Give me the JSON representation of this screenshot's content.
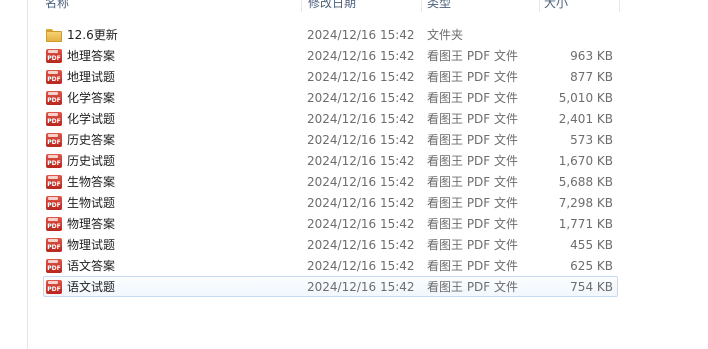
{
  "header": {
    "name": "名称",
    "date": "修改日期",
    "type": "类型",
    "size": "大小"
  },
  "files": [
    {
      "name": "12.6更新",
      "date": "2024/12/16 15:42",
      "type": "文件夹",
      "size": "",
      "icon": "folder-icon"
    },
    {
      "name": "地理答案",
      "date": "2024/12/16 15:42",
      "type": "看图王 PDF 文件",
      "size": "963 KB",
      "icon": "pdf-icon"
    },
    {
      "name": "地理试题",
      "date": "2024/12/16 15:42",
      "type": "看图王 PDF 文件",
      "size": "877 KB",
      "icon": "pdf-icon"
    },
    {
      "name": "化学答案",
      "date": "2024/12/16 15:42",
      "type": "看图王 PDF 文件",
      "size": "5,010 KB",
      "icon": "pdf-icon"
    },
    {
      "name": "化学试题",
      "date": "2024/12/16 15:42",
      "type": "看图王 PDF 文件",
      "size": "2,401 KB",
      "icon": "pdf-icon"
    },
    {
      "name": "历史答案",
      "date": "2024/12/16 15:42",
      "type": "看图王 PDF 文件",
      "size": "573 KB",
      "icon": "pdf-icon"
    },
    {
      "name": "历史试题",
      "date": "2024/12/16 15:42",
      "type": "看图王 PDF 文件",
      "size": "1,670 KB",
      "icon": "pdf-icon"
    },
    {
      "name": "生物答案",
      "date": "2024/12/16 15:42",
      "type": "看图王 PDF 文件",
      "size": "5,688 KB",
      "icon": "pdf-icon"
    },
    {
      "name": "生物试题",
      "date": "2024/12/16 15:42",
      "type": "看图王 PDF 文件",
      "size": "7,298 KB",
      "icon": "pdf-icon"
    },
    {
      "name": "物理答案",
      "date": "2024/12/16 15:42",
      "type": "看图王 PDF 文件",
      "size": "1,771 KB",
      "icon": "pdf-icon"
    },
    {
      "name": "物理试题",
      "date": "2024/12/16 15:42",
      "type": "看图王 PDF 文件",
      "size": "455 KB",
      "icon": "pdf-icon"
    },
    {
      "name": "语文答案",
      "date": "2024/12/16 15:42",
      "type": "看图王 PDF 文件",
      "size": "625 KB",
      "icon": "pdf-icon"
    },
    {
      "name": "语文试题",
      "date": "2024/12/16 15:42",
      "type": "看图王 PDF 文件",
      "size": "754 KB",
      "icon": "pdf-icon",
      "selected": true
    }
  ],
  "pdf_badge_text": "PDF",
  "colors": {
    "selection_border": "#c6dbf2",
    "selection_bg": "#f1f7fd",
    "header_text": "#4c607a",
    "secondary_text": "#6d6d6d"
  }
}
